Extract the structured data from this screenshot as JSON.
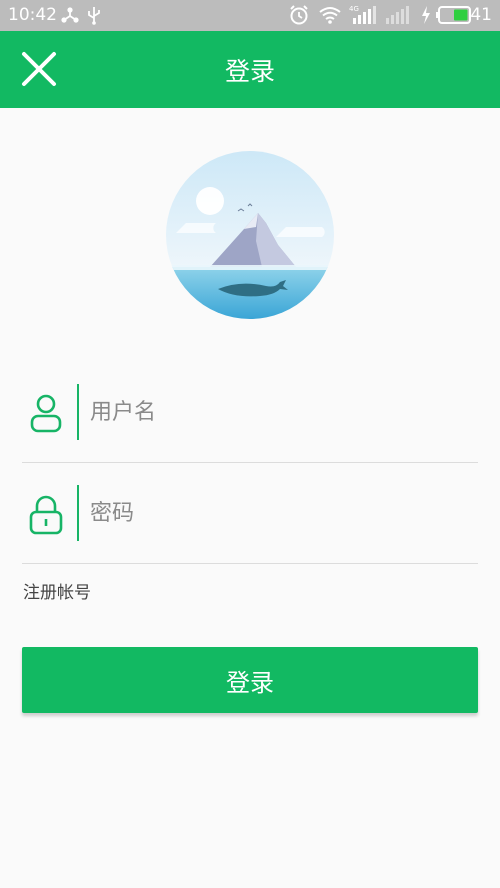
{
  "status_bar": {
    "time": "10:42",
    "battery_level": "41",
    "network_label": "4G",
    "icons": [
      "share-icon",
      "usb-icon",
      "alarm-icon",
      "wifi-icon",
      "signal-icon",
      "signal-empty-icon",
      "charging-icon",
      "battery-icon"
    ]
  },
  "app_bar": {
    "title": "登录",
    "close_icon": "close-icon"
  },
  "form": {
    "username_placeholder": "用户名",
    "password_placeholder": "密码",
    "username_value": "",
    "password_value": "",
    "register_label": "注册帐号",
    "login_label": "登录"
  },
  "colors": {
    "primary": "#12b962",
    "status_bar": "#bcbcbc",
    "background": "#fafafa",
    "divider": "#dcdcdc"
  }
}
